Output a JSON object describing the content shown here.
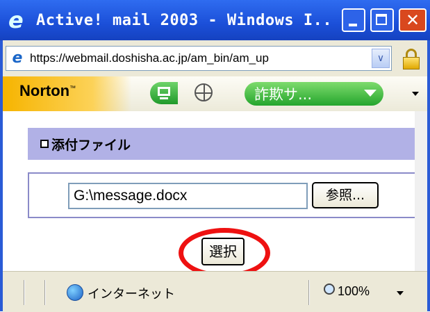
{
  "window": {
    "title": "Active! mail 2003 - Windows I..",
    "controls": {
      "minimize": "",
      "maximize": "",
      "close": "✕"
    }
  },
  "addressbar": {
    "url": "https://webmail.doshisha.ac.jp/am_bin/am_up",
    "dropdown_glyph": "∨"
  },
  "norton": {
    "brand": "Norton",
    "brand_tm": "™",
    "fraud_button": "詐欺サ..."
  },
  "content": {
    "section_title": "添付ファイル",
    "file_value": "G:\\message.docx",
    "browse_label": "参照...",
    "select_label": "選択"
  },
  "statusbar": {
    "zone": "インターネット",
    "zoom": "100%"
  },
  "colors": {
    "titlebar": "#1b4fd8",
    "section_header": "#b1b1e6",
    "highlight": "#e11111",
    "norton_yellow": "#f6b400"
  }
}
